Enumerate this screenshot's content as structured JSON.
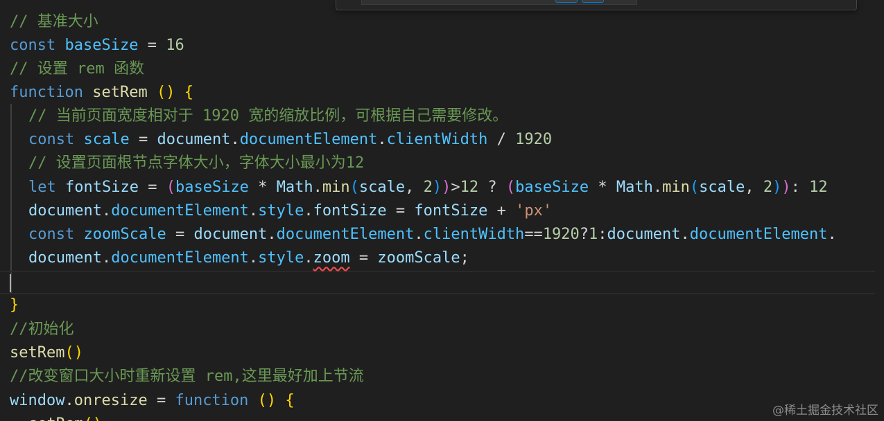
{
  "lines": [
    [
      {
        "t": "// 基准大小",
        "c": "comment"
      }
    ],
    [
      {
        "t": "const",
        "c": "keyword"
      },
      {
        "t": " "
      },
      {
        "t": "baseSize",
        "c": "prop"
      },
      {
        "t": " = "
      },
      {
        "t": "16",
        "c": "num"
      }
    ],
    [
      {
        "t": "// 设置 rem 函数",
        "c": "comment"
      }
    ],
    [
      {
        "t": "function",
        "c": "keyword"
      },
      {
        "t": " "
      },
      {
        "t": "setRem",
        "c": "func"
      },
      {
        "t": " "
      },
      {
        "t": "()",
        "c": "bracket1"
      },
      {
        "t": " "
      },
      {
        "t": "{",
        "c": "bracket1"
      }
    ],
    [
      {
        "t": "// 当前页面宽度相对于 1920 宽的缩放比例，可根据自己需要修改。",
        "c": "comment"
      }
    ],
    [
      {
        "t": "const",
        "c": "keyword"
      },
      {
        "t": " "
      },
      {
        "t": "scale",
        "c": "prop"
      },
      {
        "t": " = "
      },
      {
        "t": "document",
        "c": "var"
      },
      {
        "t": "."
      },
      {
        "t": "documentElement",
        "c": "prop"
      },
      {
        "t": "."
      },
      {
        "t": "clientWidth",
        "c": "prop"
      },
      {
        "t": " / "
      },
      {
        "t": "1920",
        "c": "num"
      }
    ],
    [
      {
        "t": "// 设置页面根节点字体大小，字体大小最小为12",
        "c": "comment"
      }
    ],
    [
      {
        "t": "let",
        "c": "keyword"
      },
      {
        "t": " "
      },
      {
        "t": "fontSize",
        "c": "var"
      },
      {
        "t": " = "
      },
      {
        "t": "(",
        "c": "bracket2"
      },
      {
        "t": "baseSize",
        "c": "prop"
      },
      {
        "t": " * "
      },
      {
        "t": "Math",
        "c": "var"
      },
      {
        "t": "."
      },
      {
        "t": "min",
        "c": "func"
      },
      {
        "t": "(",
        "c": "bracket3"
      },
      {
        "t": "scale",
        "c": "var"
      },
      {
        "t": ", "
      },
      {
        "t": "2",
        "c": "num"
      },
      {
        "t": ")",
        "c": "bracket3"
      },
      {
        "t": ")",
        "c": "bracket2"
      },
      {
        "t": ">"
      },
      {
        "t": "12",
        "c": "num"
      },
      {
        "t": " ? "
      },
      {
        "t": "(",
        "c": "bracket2"
      },
      {
        "t": "baseSize",
        "c": "prop"
      },
      {
        "t": " * "
      },
      {
        "t": "Math",
        "c": "var"
      },
      {
        "t": "."
      },
      {
        "t": "min",
        "c": "func"
      },
      {
        "t": "(",
        "c": "bracket3"
      },
      {
        "t": "scale",
        "c": "var"
      },
      {
        "t": ", "
      },
      {
        "t": "2",
        "c": "num"
      },
      {
        "t": ")",
        "c": "bracket3"
      },
      {
        "t": ")",
        "c": "bracket2"
      },
      {
        "t": ": "
      },
      {
        "t": "12",
        "c": "num"
      }
    ],
    [
      {
        "t": "document",
        "c": "var"
      },
      {
        "t": "."
      },
      {
        "t": "documentElement",
        "c": "prop"
      },
      {
        "t": "."
      },
      {
        "t": "style",
        "c": "prop"
      },
      {
        "t": "."
      },
      {
        "t": "fontSize",
        "c": "var"
      },
      {
        "t": " = "
      },
      {
        "t": "fontSize",
        "c": "var"
      },
      {
        "t": " + "
      },
      {
        "t": "'px'",
        "c": "str"
      }
    ],
    [
      {
        "t": "const",
        "c": "keyword"
      },
      {
        "t": " "
      },
      {
        "t": "zoomScale",
        "c": "prop"
      },
      {
        "t": " = "
      },
      {
        "t": "document",
        "c": "var"
      },
      {
        "t": "."
      },
      {
        "t": "documentElement",
        "c": "prop"
      },
      {
        "t": "."
      },
      {
        "t": "clientWidth",
        "c": "prop"
      },
      {
        "t": "=="
      },
      {
        "t": "1920",
        "c": "num"
      },
      {
        "t": "?"
      },
      {
        "t": "1",
        "c": "num"
      },
      {
        "t": ":"
      },
      {
        "t": "document",
        "c": "var"
      },
      {
        "t": "."
      },
      {
        "t": "documentElement",
        "c": "prop"
      },
      {
        "t": "."
      }
    ],
    [
      {
        "t": "document",
        "c": "var"
      },
      {
        "t": "."
      },
      {
        "t": "documentElement",
        "c": "prop"
      },
      {
        "t": "."
      },
      {
        "t": "style",
        "c": "prop"
      },
      {
        "t": "."
      },
      {
        "t": "zoom",
        "c": "var",
        "s": true
      },
      {
        "t": " = "
      },
      {
        "t": "zoomScale",
        "c": "var"
      },
      {
        "t": ";"
      }
    ],
    [],
    [
      {
        "t": "}",
        "c": "bracket1"
      }
    ],
    [
      {
        "t": "//初始化",
        "c": "comment"
      }
    ],
    [
      {
        "t": "setRem",
        "c": "func"
      },
      {
        "t": "()",
        "c": "bracket1"
      }
    ],
    [
      {
        "t": "//改变窗口大小时重新设置 rem,这里最好加上节流",
        "c": "comment"
      }
    ],
    [
      {
        "t": "window",
        "c": "var"
      },
      {
        "t": "."
      },
      {
        "t": "onresize",
        "c": "func"
      },
      {
        "t": " = "
      },
      {
        "t": "function",
        "c": "keyword"
      },
      {
        "t": " "
      },
      {
        "t": "()",
        "c": "bracket1"
      },
      {
        "t": " "
      },
      {
        "t": "{",
        "c": "bracket1"
      }
    ],
    [
      {
        "t": "setRem",
        "c": "func"
      },
      {
        "t": "()",
        "c": "bracket1"
      }
    ]
  ],
  "watermark": "@稀土掘金技术社区",
  "colors": {
    "background": "#1f1f1f",
    "comment": "#6a9955",
    "keyword": "#569cd6",
    "function": "#dcdcaa",
    "variable": "#9cdcfe",
    "number": "#b5cea8",
    "string": "#ce9178",
    "bracket": "#ffd700"
  }
}
